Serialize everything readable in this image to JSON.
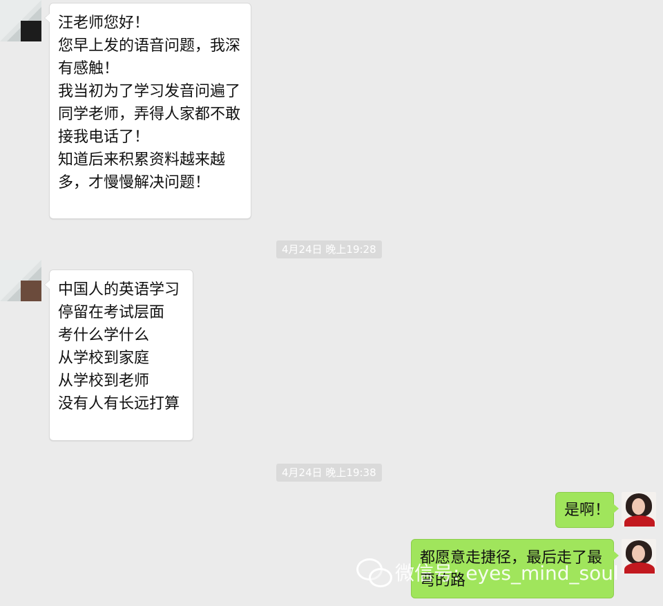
{
  "messages": [
    {
      "id": "m1",
      "from": "other",
      "lines": [
        "汪老师您好！",
        "您早上发的语音问题，我深",
        "有感触！",
        "我当初为了学习发音问遍了",
        "同学老师，弄得人家都不敢",
        "接我电话了！",
        "知道后来积累资料越来越",
        "多，才慢慢解决问题！"
      ]
    },
    {
      "id": "m2",
      "from": "other",
      "lines": [
        "中国人的英语学习",
        "停留在考试层面",
        "考什么学什么",
        "从学校到家庭",
        "从学校到老师",
        "没有人有长远打算"
      ]
    },
    {
      "id": "m3",
      "from": "self",
      "lines": [
        "是啊！"
      ]
    },
    {
      "id": "m4",
      "from": "self",
      "lines": [
        "都愿意走捷径，最后走了最",
        "弯的路"
      ]
    }
  ],
  "timestamps": [
    "4月24日 晚上19:28",
    "4月24日 晚上19:38"
  ],
  "watermark": "微信号: eyes_mind_soul",
  "colors": {
    "background": "#ebebeb",
    "incoming_bubble": "#ffffff",
    "outgoing_bubble": "#a0e55c",
    "timestamp_bg": "#dadada",
    "avatar_dress": "#c2191f"
  },
  "icons": {
    "watermark": "wechat-icon",
    "contact_avatar": "contact-avatar",
    "self_avatar": "self-avatar"
  }
}
